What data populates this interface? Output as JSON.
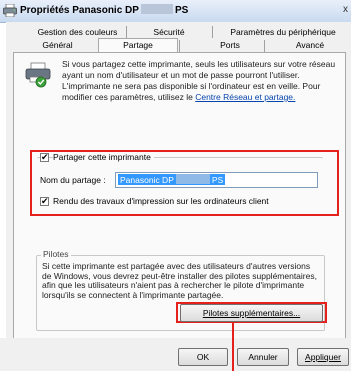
{
  "window": {
    "title_left": "Propriétés Panasonic DP",
    "title_right": "PS",
    "close_glyph": "x"
  },
  "tabs": {
    "row1": [
      "Gestion des couleurs",
      "Sécurité",
      "Paramètres du périphérique"
    ],
    "row2": [
      "Général",
      "Partage",
      "Ports",
      "Avancé"
    ],
    "active": "Partage"
  },
  "info": {
    "text": "Si vous partagez cette imprimante, seuls les utilisateurs sur votre réseau ayant un nom d'utilisateur et un mot de passe pourront l'utiliser. L'imprimante ne sera pas disponible si l'ordinateur est en veille. Pour modifier ces paramètres, utilisez le ",
    "link": "Centre Réseau et partage."
  },
  "sharing": {
    "share_checkbox_label": "Partager cette imprimante",
    "share_checked": true,
    "share_name_label": "Nom du partage :",
    "share_name_left": "Panasonic DP",
    "share_name_right": "PS",
    "render_checkbox_label": "Rendu des travaux d'impression sur les ordinateurs client",
    "render_checked": true
  },
  "drivers": {
    "group_label": "Pilotes",
    "text": "Si cette imprimante est partagée avec des utilisateurs d'autres versions de Windows, vous devrez peut-être installer des pilotes supplémentaires, afin que les utilisateurs n'aient pas à rechercher le pilote d'imprimante lorsqu'ils se connectent à l'imprimante partagée.",
    "additional_button": "Pilotes supplémentaires..."
  },
  "footer": {
    "ok": "OK",
    "cancel": "Annuler",
    "apply": "Appliquer"
  },
  "colors": {
    "highlight": "#e4211b",
    "selection": "#3399ff",
    "link": "#0645ad"
  }
}
